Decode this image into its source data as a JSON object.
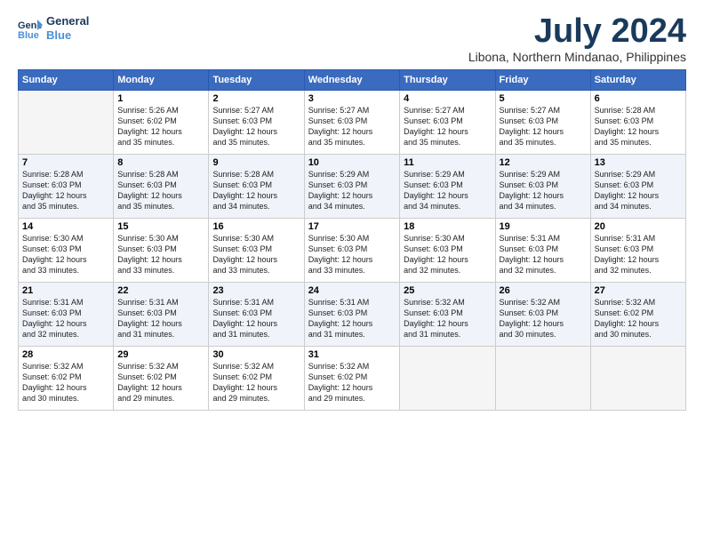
{
  "logo": {
    "line1": "General",
    "line2": "Blue"
  },
  "title": "July 2024",
  "subtitle": "Libona, Northern Mindanao, Philippines",
  "header": {
    "days": [
      "Sunday",
      "Monday",
      "Tuesday",
      "Wednesday",
      "Thursday",
      "Friday",
      "Saturday"
    ]
  },
  "weeks": [
    {
      "shade": "white",
      "days": [
        {
          "num": "",
          "info": "",
          "empty": true
        },
        {
          "num": "1",
          "info": "Sunrise: 5:26 AM\nSunset: 6:02 PM\nDaylight: 12 hours\nand 35 minutes."
        },
        {
          "num": "2",
          "info": "Sunrise: 5:27 AM\nSunset: 6:03 PM\nDaylight: 12 hours\nand 35 minutes."
        },
        {
          "num": "3",
          "info": "Sunrise: 5:27 AM\nSunset: 6:03 PM\nDaylight: 12 hours\nand 35 minutes."
        },
        {
          "num": "4",
          "info": "Sunrise: 5:27 AM\nSunset: 6:03 PM\nDaylight: 12 hours\nand 35 minutes."
        },
        {
          "num": "5",
          "info": "Sunrise: 5:27 AM\nSunset: 6:03 PM\nDaylight: 12 hours\nand 35 minutes."
        },
        {
          "num": "6",
          "info": "Sunrise: 5:28 AM\nSunset: 6:03 PM\nDaylight: 12 hours\nand 35 minutes."
        }
      ]
    },
    {
      "shade": "shaded",
      "days": [
        {
          "num": "7",
          "info": "Sunrise: 5:28 AM\nSunset: 6:03 PM\nDaylight: 12 hours\nand 35 minutes."
        },
        {
          "num": "8",
          "info": "Sunrise: 5:28 AM\nSunset: 6:03 PM\nDaylight: 12 hours\nand 35 minutes."
        },
        {
          "num": "9",
          "info": "Sunrise: 5:28 AM\nSunset: 6:03 PM\nDaylight: 12 hours\nand 34 minutes."
        },
        {
          "num": "10",
          "info": "Sunrise: 5:29 AM\nSunset: 6:03 PM\nDaylight: 12 hours\nand 34 minutes."
        },
        {
          "num": "11",
          "info": "Sunrise: 5:29 AM\nSunset: 6:03 PM\nDaylight: 12 hours\nand 34 minutes."
        },
        {
          "num": "12",
          "info": "Sunrise: 5:29 AM\nSunset: 6:03 PM\nDaylight: 12 hours\nand 34 minutes."
        },
        {
          "num": "13",
          "info": "Sunrise: 5:29 AM\nSunset: 6:03 PM\nDaylight: 12 hours\nand 34 minutes."
        }
      ]
    },
    {
      "shade": "white",
      "days": [
        {
          "num": "14",
          "info": "Sunrise: 5:30 AM\nSunset: 6:03 PM\nDaylight: 12 hours\nand 33 minutes."
        },
        {
          "num": "15",
          "info": "Sunrise: 5:30 AM\nSunset: 6:03 PM\nDaylight: 12 hours\nand 33 minutes."
        },
        {
          "num": "16",
          "info": "Sunrise: 5:30 AM\nSunset: 6:03 PM\nDaylight: 12 hours\nand 33 minutes."
        },
        {
          "num": "17",
          "info": "Sunrise: 5:30 AM\nSunset: 6:03 PM\nDaylight: 12 hours\nand 33 minutes."
        },
        {
          "num": "18",
          "info": "Sunrise: 5:30 AM\nSunset: 6:03 PM\nDaylight: 12 hours\nand 32 minutes."
        },
        {
          "num": "19",
          "info": "Sunrise: 5:31 AM\nSunset: 6:03 PM\nDaylight: 12 hours\nand 32 minutes."
        },
        {
          "num": "20",
          "info": "Sunrise: 5:31 AM\nSunset: 6:03 PM\nDaylight: 12 hours\nand 32 minutes."
        }
      ]
    },
    {
      "shade": "shaded",
      "days": [
        {
          "num": "21",
          "info": "Sunrise: 5:31 AM\nSunset: 6:03 PM\nDaylight: 12 hours\nand 32 minutes."
        },
        {
          "num": "22",
          "info": "Sunrise: 5:31 AM\nSunset: 6:03 PM\nDaylight: 12 hours\nand 31 minutes."
        },
        {
          "num": "23",
          "info": "Sunrise: 5:31 AM\nSunset: 6:03 PM\nDaylight: 12 hours\nand 31 minutes."
        },
        {
          "num": "24",
          "info": "Sunrise: 5:31 AM\nSunset: 6:03 PM\nDaylight: 12 hours\nand 31 minutes."
        },
        {
          "num": "25",
          "info": "Sunrise: 5:32 AM\nSunset: 6:03 PM\nDaylight: 12 hours\nand 31 minutes."
        },
        {
          "num": "26",
          "info": "Sunrise: 5:32 AM\nSunset: 6:03 PM\nDaylight: 12 hours\nand 30 minutes."
        },
        {
          "num": "27",
          "info": "Sunrise: 5:32 AM\nSunset: 6:02 PM\nDaylight: 12 hours\nand 30 minutes."
        }
      ]
    },
    {
      "shade": "white",
      "days": [
        {
          "num": "28",
          "info": "Sunrise: 5:32 AM\nSunset: 6:02 PM\nDaylight: 12 hours\nand 30 minutes."
        },
        {
          "num": "29",
          "info": "Sunrise: 5:32 AM\nSunset: 6:02 PM\nDaylight: 12 hours\nand 29 minutes."
        },
        {
          "num": "30",
          "info": "Sunrise: 5:32 AM\nSunset: 6:02 PM\nDaylight: 12 hours\nand 29 minutes."
        },
        {
          "num": "31",
          "info": "Sunrise: 5:32 AM\nSunset: 6:02 PM\nDaylight: 12 hours\nand 29 minutes."
        },
        {
          "num": "",
          "info": "",
          "empty": true
        },
        {
          "num": "",
          "info": "",
          "empty": true
        },
        {
          "num": "",
          "info": "",
          "empty": true
        }
      ]
    }
  ]
}
